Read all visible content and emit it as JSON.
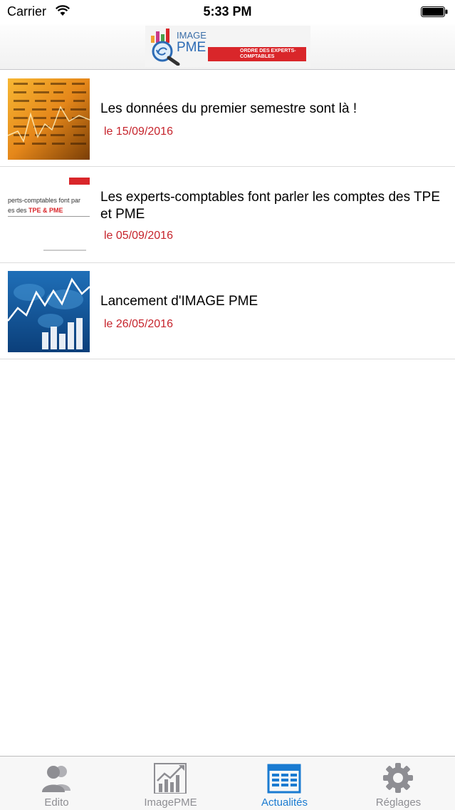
{
  "status_bar": {
    "carrier": "Carrier",
    "time": "5:33 PM"
  },
  "header": {
    "logo_image_text": "IMAGE",
    "logo_pme_text": "PME",
    "logo_org_text": "ORDRE DES EXPERTS-COMPTABLES"
  },
  "news": [
    {
      "title": "Les données du premier semestre sont là !",
      "date": "le 15/09/2016",
      "thumb_icon": "stock-ticker-image"
    },
    {
      "title": "Les experts-comptables font parler les comptes des TPE et PME",
      "date": "le 05/09/2016",
      "thumb_icon": "document-cover-image",
      "thumb_text_line1": "perts-comptables font par",
      "thumb_text_line2_prefix": "es des ",
      "thumb_text_line2_highlight": "TPE & PME"
    },
    {
      "title": "Lancement d'IMAGE PME",
      "date": "le 26/05/2016",
      "thumb_icon": "growth-chart-image"
    }
  ],
  "tabs": [
    {
      "label": "Edito",
      "icon": "users-icon",
      "active": false
    },
    {
      "label": "ImagePME",
      "icon": "chart-icon",
      "active": false
    },
    {
      "label": "Actualités",
      "icon": "news-table-icon",
      "active": true
    },
    {
      "label": "Réglages",
      "icon": "gear-icon",
      "active": false
    }
  ],
  "colors": {
    "accent": "#1a7bd1",
    "date_red": "#c6242c",
    "inactive_tab": "#8e8e93"
  }
}
